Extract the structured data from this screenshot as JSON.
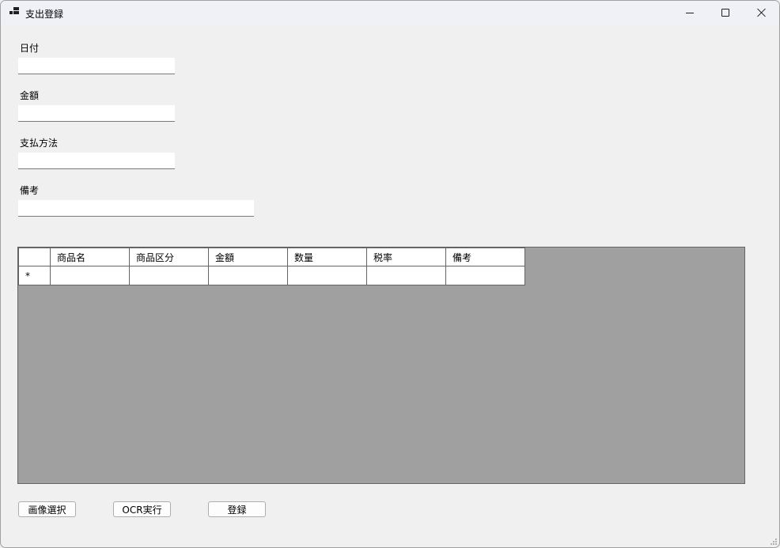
{
  "window": {
    "title": "支出登録",
    "colors": {
      "titlebar": "#eff1f6",
      "body": "#f0f0f0",
      "grid_background": "#a0a0a0"
    }
  },
  "form": {
    "date_label": "日付",
    "date_value": "",
    "amount_label": "金額",
    "amount_value": "",
    "payment_label": "支払方法",
    "payment_value": "",
    "note_label": "備考",
    "note_value": ""
  },
  "grid": {
    "columns": [
      "商品名",
      "商品区分",
      "金額",
      "数量",
      "税率",
      "備考"
    ],
    "new_row_marker": "*",
    "rows": []
  },
  "buttons": {
    "select_image": "画像選択",
    "run_ocr": "OCR実行",
    "register": "登録"
  }
}
